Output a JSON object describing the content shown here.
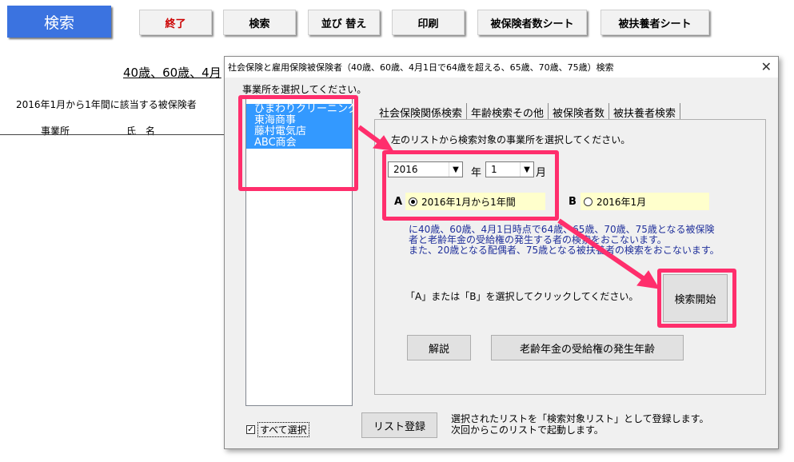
{
  "toolbar": {
    "title_button": "検索",
    "buttons": [
      {
        "label": "終了",
        "color": "#cc0000"
      },
      {
        "label": "検索",
        "color": "#000000"
      },
      {
        "label": "並び 替え",
        "color": "#000000"
      },
      {
        "label": "印刷",
        "color": "#000000"
      },
      {
        "label": "被保険者数シート",
        "color": "#000000"
      },
      {
        "label": "被扶養者シート",
        "color": "#000000"
      }
    ]
  },
  "background": {
    "heading": "40歳、60歳、4月",
    "info_line": "2016年1月から1年間に該当する被保険者",
    "col_office": "事業所",
    "col_name": "氏　名"
  },
  "dialog": {
    "title": "社会保険と雇用保険被保険者（40歳、60歳、4月1日で64歳を超える、65歳、70歳、75歳）検索",
    "close": "✕",
    "select_office_label": "事業所を選択してください。",
    "offices": [
      "ひまわりクリーニング",
      "東海商事",
      "藤村電気店",
      "ABC商会"
    ],
    "tabs": [
      "社会保険関係検索",
      "年齢検索その他",
      "被保険者数",
      "被扶養者検索"
    ],
    "instruction": "左のリストから検索対象の事業所を選択してください。",
    "year_value": "2016",
    "year_suffix": "年",
    "month_value": "1",
    "month_suffix": "月",
    "option_a_label": "A",
    "option_a_text": "2016年1月から1年間",
    "option_b_label": "B",
    "option_b_text": "2016年1月",
    "description": [
      "に40歳、60歳、4月1日時点で64歳、65歳、70歳、75歳となる被保険",
      "者と老齢年金の受給権の発生する者の検索をおこないます。",
      "また、20歳となる配偶者、75歳となる被扶養者の検索をおこないます。"
    ],
    "select_ab_prompt": "「A」または「B」を選択してクリックしてください。",
    "search_start_button": "検索開始",
    "explain_button": "解説",
    "pension_button": "老齢年金の受給権の発生年齢",
    "select_all_label": "すべて選択",
    "register_button": "リスト登録",
    "register_note": [
      "選択されたリストを「検索対象リスト」として登録します。",
      "次回からこのリストで起動します。"
    ]
  },
  "colors": {
    "title_button_bg": "#3b73e0",
    "highlight": "#ff2e6c",
    "selection": "#3399ff",
    "option_bg": "#ffffcc",
    "description_text": "#1f2f9a"
  }
}
